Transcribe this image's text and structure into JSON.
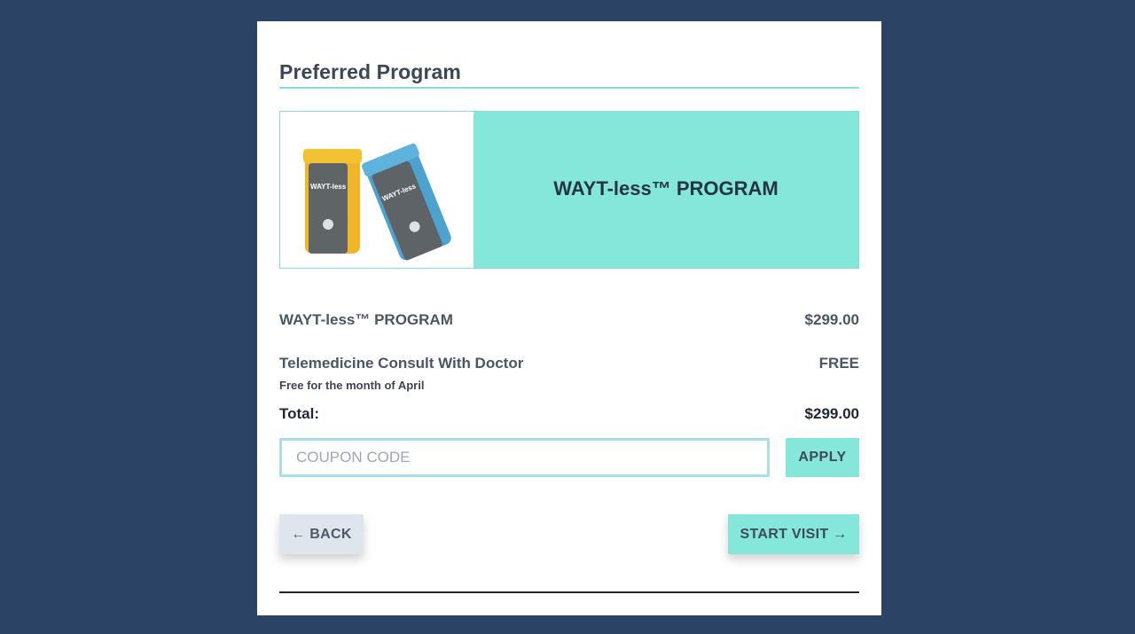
{
  "section": {
    "title": "Preferred Program"
  },
  "banner": {
    "program_name": "WAYT-less™ PROGRAM",
    "product_image_icon": "pill-bottles-image",
    "bottle_label": "WAYT-less"
  },
  "order": {
    "items": [
      {
        "name": "WAYT-less™ PROGRAM",
        "price": "$299.00"
      },
      {
        "name": "Telemedicine Consult With Doctor",
        "price": "FREE",
        "note": "Free for the month of April"
      }
    ],
    "total_label": "Total:",
    "total_value": "$299.00"
  },
  "coupon": {
    "placeholder": "COUPON CODE",
    "value": "",
    "apply_label": "APPLY"
  },
  "actions": {
    "back_label": "← BACK",
    "start_label": "START VISIT →"
  },
  "colors": {
    "background": "#2b4466",
    "accent": "#85e6da",
    "input_border": "#a8dcef"
  }
}
